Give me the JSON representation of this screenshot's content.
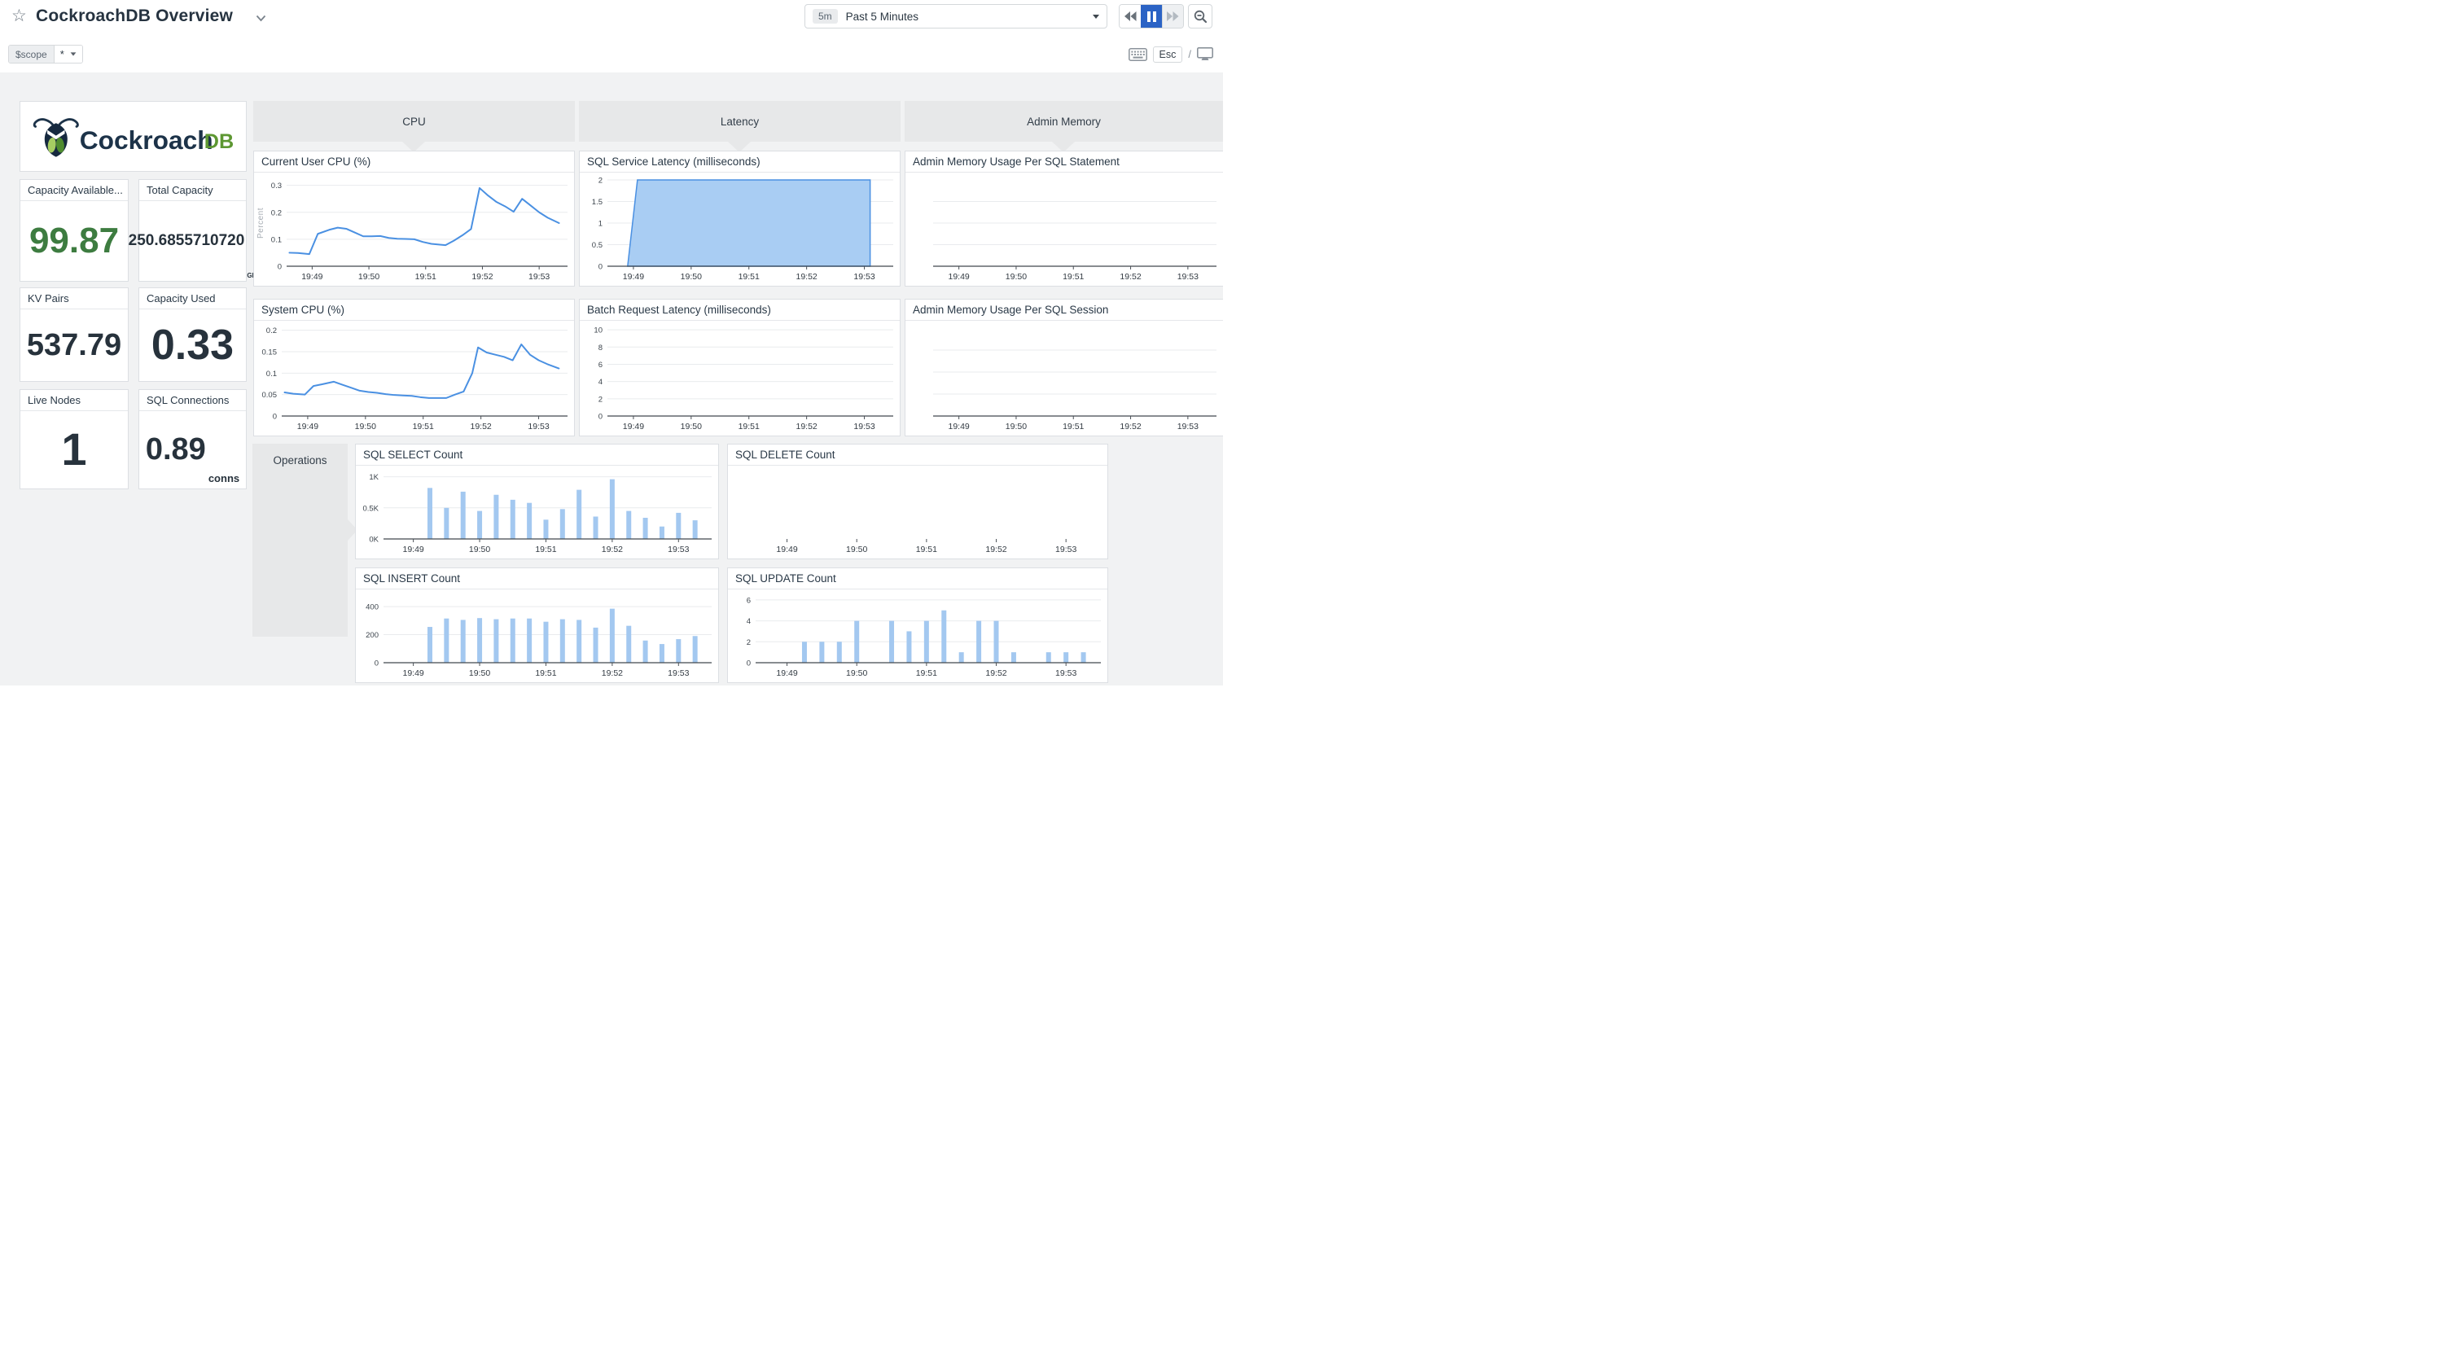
{
  "header": {
    "title": "CockroachDB Overview"
  },
  "controls": {
    "time_range_badge": "5m",
    "time_range_label": "Past 5 Minutes",
    "scope_name": "$scope",
    "scope_value": "*",
    "esc_label": "Esc",
    "slash": "/"
  },
  "logo": {
    "word": "Cockroach",
    "suffix": "DB"
  },
  "stats": {
    "capacity_available": {
      "title": "Capacity Available...",
      "value": "99.87"
    },
    "total_capacity": {
      "title": "Total Capacity",
      "value": "250.6855710720",
      "unit": "GB"
    },
    "kv_pairs": {
      "title": "KV Pairs",
      "value": "537.79"
    },
    "capacity_used": {
      "title": "Capacity Used",
      "value": "0.33"
    },
    "live_nodes": {
      "title": "Live Nodes",
      "value": "1"
    },
    "sql_connections": {
      "title": "SQL Connections",
      "value": "0.89",
      "unit": "conns"
    }
  },
  "groups": {
    "cpu": "CPU",
    "latency": "Latency",
    "admin_memory": "Admin Memory",
    "operations": "Operations"
  },
  "chart_data": {
    "colors": {
      "line": "#4a90e2",
      "area_fill": "#a9cdf3",
      "bar": "#a3c8f0"
    },
    "x_axis": {
      "range": [
        48.55,
        53.5
      ],
      "ticks": [
        {
          "t": 49,
          "label": "19:49"
        },
        {
          "t": 50,
          "label": "19:50"
        },
        {
          "t": 51,
          "label": "19:51"
        },
        {
          "t": 52,
          "label": "19:52"
        },
        {
          "t": 53,
          "label": "19:53"
        }
      ]
    },
    "charts": {
      "current_user_cpu": {
        "type": "line",
        "title": "Current User CPU (%)",
        "ylabel": "Percent",
        "y_max": 0.32,
        "axis": true,
        "y_ticks": [
          {
            "v": 0,
            "label": "0"
          },
          {
            "v": 0.1,
            "label": "0.1"
          },
          {
            "v": 0.2,
            "label": "0.2"
          },
          {
            "v": 0.3,
            "label": "0.3"
          }
        ],
        "points": [
          [
            48.6,
            0.05
          ],
          [
            48.75,
            0.049
          ],
          [
            48.95,
            0.045
          ],
          [
            49.1,
            0.12
          ],
          [
            49.3,
            0.135
          ],
          [
            49.45,
            0.143
          ],
          [
            49.6,
            0.139
          ],
          [
            49.75,
            0.125
          ],
          [
            49.9,
            0.111
          ],
          [
            50.05,
            0.111
          ],
          [
            50.2,
            0.112
          ],
          [
            50.35,
            0.105
          ],
          [
            50.5,
            0.102
          ],
          [
            50.65,
            0.101
          ],
          [
            50.8,
            0.1
          ],
          [
            50.95,
            0.09
          ],
          [
            51.1,
            0.083
          ],
          [
            51.25,
            0.08
          ],
          [
            51.35,
            0.078
          ],
          [
            51.5,
            0.095
          ],
          [
            51.65,
            0.115
          ],
          [
            51.8,
            0.138
          ],
          [
            51.95,
            0.29
          ],
          [
            52.1,
            0.262
          ],
          [
            52.25,
            0.238
          ],
          [
            52.4,
            0.222
          ],
          [
            52.55,
            0.202
          ],
          [
            52.7,
            0.25
          ],
          [
            52.85,
            0.225
          ],
          [
            53.0,
            0.2
          ],
          [
            53.15,
            0.18
          ],
          [
            53.35,
            0.16
          ]
        ]
      },
      "system_cpu": {
        "type": "line",
        "title": "System CPU (%)",
        "y_max": 0.205,
        "axis": true,
        "y_ticks": [
          {
            "v": 0,
            "label": "0"
          },
          {
            "v": 0.05,
            "label": "0.05"
          },
          {
            "v": 0.1,
            "label": "0.1"
          },
          {
            "v": 0.15,
            "label": "0.15"
          },
          {
            "v": 0.2,
            "label": "0.2"
          }
        ],
        "points": [
          [
            48.6,
            0.055
          ],
          [
            48.75,
            0.052
          ],
          [
            48.95,
            0.05
          ],
          [
            49.1,
            0.07
          ],
          [
            49.25,
            0.074
          ],
          [
            49.45,
            0.08
          ],
          [
            49.6,
            0.073
          ],
          [
            49.75,
            0.066
          ],
          [
            49.9,
            0.059
          ],
          [
            50.05,
            0.056
          ],
          [
            50.2,
            0.054
          ],
          [
            50.35,
            0.051
          ],
          [
            50.5,
            0.049
          ],
          [
            50.65,
            0.048
          ],
          [
            50.8,
            0.047
          ],
          [
            50.95,
            0.044
          ],
          [
            51.1,
            0.042
          ],
          [
            51.25,
            0.042
          ],
          [
            51.4,
            0.042
          ],
          [
            51.55,
            0.05
          ],
          [
            51.7,
            0.057
          ],
          [
            51.85,
            0.1
          ],
          [
            51.95,
            0.16
          ],
          [
            52.1,
            0.148
          ],
          [
            52.25,
            0.143
          ],
          [
            52.4,
            0.138
          ],
          [
            52.55,
            0.13
          ],
          [
            52.7,
            0.167
          ],
          [
            52.85,
            0.143
          ],
          [
            53.0,
            0.13
          ],
          [
            53.15,
            0.121
          ],
          [
            53.35,
            0.111
          ]
        ]
      },
      "sql_service_latency": {
        "type": "area",
        "title": "SQL Service Latency (milliseconds)",
        "y_max": 2,
        "axis": true,
        "y_ticks": [
          {
            "v": 0,
            "label": "0"
          },
          {
            "v": 0.5,
            "label": "0.5"
          },
          {
            "v": 1,
            "label": "1"
          },
          {
            "v": 1.5,
            "label": "1.5"
          },
          {
            "v": 2,
            "label": "2"
          }
        ],
        "points": [
          [
            48.9,
            0
          ],
          [
            49.07,
            2
          ],
          [
            53.1,
            2
          ],
          [
            53.1,
            0
          ]
        ]
      },
      "batch_request_latency": {
        "type": "empty",
        "title": "Batch Request Latency (milliseconds)",
        "y_max": 10.2,
        "axis": true,
        "y_ticks": [
          {
            "v": 0,
            "label": "0"
          },
          {
            "v": 2,
            "label": "2"
          },
          {
            "v": 4,
            "label": "4"
          },
          {
            "v": 6,
            "label": "6"
          },
          {
            "v": 8,
            "label": "8"
          },
          {
            "v": 10,
            "label": "10"
          }
        ]
      },
      "admin_mem_statement": {
        "type": "empty",
        "title": "Admin Memory Usage Per SQL Statement",
        "y_max": 1,
        "axis": true,
        "y_ticks": [
          {
            "v": 0.25,
            "label": ""
          },
          {
            "v": 0.5,
            "label": ""
          },
          {
            "v": 0.75,
            "label": ""
          }
        ]
      },
      "admin_mem_session": {
        "type": "empty",
        "title": "Admin Memory Usage Per SQL Session",
        "y_max": 1,
        "axis": true,
        "y_ticks": [
          {
            "v": 0.25,
            "label": ""
          },
          {
            "v": 0.5,
            "label": ""
          },
          {
            "v": 0.75,
            "label": ""
          }
        ]
      },
      "sql_select": {
        "type": "bar",
        "title": "SQL SELECT Count",
        "y_max": 1060,
        "axis": true,
        "y_ticks": [
          {
            "v": 0,
            "label": "0K"
          },
          {
            "v": 500,
            "label": "0.5K"
          },
          {
            "v": 1000,
            "label": "1K"
          }
        ],
        "bars": {
          "start": 49.25,
          "step": 0.25,
          "values": [
            820,
            500,
            760,
            450,
            710,
            630,
            580,
            310,
            480,
            790,
            360,
            960,
            450,
            340,
            200,
            420,
            300
          ]
        }
      },
      "sql_delete": {
        "type": "empty",
        "title": "SQL DELETE Count",
        "y_max": 1,
        "axis": false,
        "y_ticks": []
      },
      "sql_insert": {
        "type": "bar",
        "title": "SQL INSERT Count",
        "y_max": 470,
        "axis": true,
        "y_ticks": [
          {
            "v": 0,
            "label": "0"
          },
          {
            "v": 200,
            "label": "200"
          },
          {
            "v": 400,
            "label": "400"
          }
        ],
        "bars": {
          "start": 49.25,
          "step": 0.25,
          "values": [
            255,
            315,
            305,
            318,
            310,
            315,
            315,
            292,
            310,
            305,
            250,
            385,
            263,
            158,
            133,
            168,
            190
          ]
        }
      },
      "sql_update": {
        "type": "bar",
        "title": "SQL UPDATE Count",
        "y_max": 6.3,
        "axis": true,
        "y_ticks": [
          {
            "v": 0,
            "label": "0"
          },
          {
            "v": 2,
            "label": "2"
          },
          {
            "v": 4,
            "label": "4"
          },
          {
            "v": 6,
            "label": "6"
          }
        ],
        "bars": {
          "start": 49.25,
          "step": 0.25,
          "values": [
            2,
            2,
            2,
            4,
            0,
            4,
            3,
            4,
            5,
            1,
            4,
            4,
            1,
            0,
            1,
            1,
            1
          ]
        }
      }
    }
  }
}
